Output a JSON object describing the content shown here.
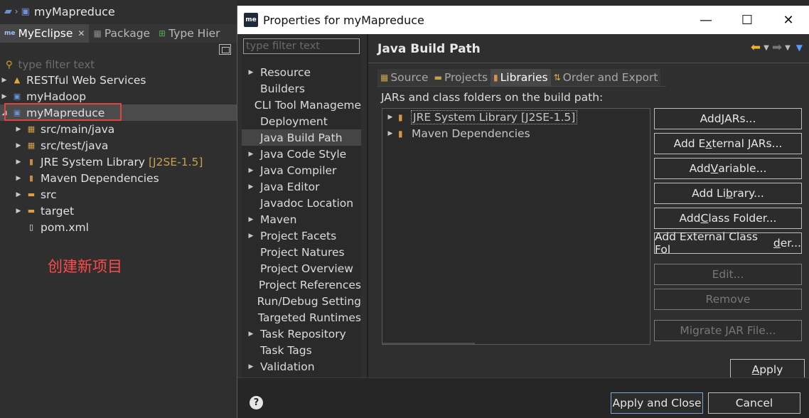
{
  "ide": {
    "breadcrumb": "myMapreduce",
    "view_tabs": [
      {
        "label": "MyEclipse",
        "active": true,
        "closable": true
      },
      {
        "label": "Package",
        "active": false
      },
      {
        "label": "Type Hier",
        "active": false
      }
    ],
    "filter_placeholder": "type filter text",
    "tree": [
      {
        "label": "RESTful Web Services",
        "icon": "rest-services-icon",
        "expanded": false,
        "level": 0
      },
      {
        "label": "myHadoop",
        "icon": "project-icon",
        "expanded": false,
        "level": 0
      },
      {
        "label": "myMapreduce",
        "icon": "project-icon",
        "expanded": true,
        "level": 0,
        "selected": true
      },
      {
        "label": "src/main/java",
        "icon": "source-folder-icon",
        "expanded": false,
        "level": 1
      },
      {
        "label": "src/test/java",
        "icon": "source-folder-icon",
        "expanded": false,
        "level": 1
      },
      {
        "label": "JRE System Library",
        "suffix": "[J2SE-1.5]",
        "icon": "library-icon",
        "expanded": false,
        "level": 1
      },
      {
        "label": "Maven Dependencies",
        "icon": "library-icon",
        "expanded": false,
        "level": 1
      },
      {
        "label": "src",
        "icon": "folder-icon",
        "expanded": false,
        "level": 1
      },
      {
        "label": "target",
        "icon": "folder-icon",
        "expanded": false,
        "level": 1
      },
      {
        "label": "pom.xml",
        "icon": "file-icon",
        "level": 1
      }
    ],
    "annotation": "创建新项目"
  },
  "dialog": {
    "logo": "me",
    "title": "Properties for myMapreduce",
    "window_buttons": {
      "minimize": "—",
      "maximize": "☐",
      "close": "✕"
    },
    "nav_filter_placeholder": "type filter text",
    "nav": [
      {
        "label": "Resource",
        "arrow": true
      },
      {
        "label": "Builders",
        "arrow": false
      },
      {
        "label": "CLI Tool Manageme",
        "arrow": false
      },
      {
        "label": "Deployment",
        "arrow": false
      },
      {
        "label": "Java Build Path",
        "arrow": false,
        "selected": true
      },
      {
        "label": "Java Code Style",
        "arrow": true
      },
      {
        "label": "Java Compiler",
        "arrow": true
      },
      {
        "label": "Java Editor",
        "arrow": true
      },
      {
        "label": "Javadoc Location",
        "arrow": false
      },
      {
        "label": "Maven",
        "arrow": true
      },
      {
        "label": "Project Facets",
        "arrow": true
      },
      {
        "label": "Project Natures",
        "arrow": false
      },
      {
        "label": "Project Overview",
        "arrow": false
      },
      {
        "label": "Project References",
        "arrow": false
      },
      {
        "label": "Run/Debug Setting",
        "arrow": false
      },
      {
        "label": "Targeted Runtimes",
        "arrow": false
      },
      {
        "label": "Task Repository",
        "arrow": true
      },
      {
        "label": "Task Tags",
        "arrow": false
      },
      {
        "label": "Validation",
        "arrow": true
      }
    ],
    "page_title": "Java Build Path",
    "tabs": [
      {
        "label": "Source",
        "icon": "source-tab-icon",
        "active": false
      },
      {
        "label": "Projects",
        "icon": "projects-tab-icon",
        "active": false
      },
      {
        "label": "Libraries",
        "icon": "libraries-tab-icon",
        "active": true
      },
      {
        "label": "Order and Export",
        "icon": "order-tab-icon",
        "active": false
      }
    ],
    "build_path_label": "JARs and class folders on the build path:",
    "libraries": [
      {
        "label": "JRE System Library [J2SE-1.5]",
        "focused": true
      },
      {
        "label": "Maven Dependencies",
        "focused": false
      }
    ],
    "buttons": [
      {
        "pre": "Add ",
        "ul": "J",
        "post": "ARs...",
        "enabled": true
      },
      {
        "pre": "Add E",
        "ul": "x",
        "post": "ternal JARs...",
        "enabled": true
      },
      {
        "pre": "Add ",
        "ul": "V",
        "post": "ariable...",
        "enabled": true
      },
      {
        "pre": "Add Li",
        "ul": "b",
        "post": "rary...",
        "enabled": true
      },
      {
        "pre": "Add ",
        "ul": "C",
        "post": "lass Folder...",
        "enabled": true
      },
      {
        "pre": "Add External Class Fol",
        "ul": "d",
        "post": "er...",
        "enabled": true
      },
      {
        "pre": "Edit...",
        "ul": "",
        "post": "",
        "enabled": false
      },
      {
        "pre": "Remove",
        "ul": "",
        "post": "",
        "enabled": false
      },
      {
        "pre": "Migrate JAR File...",
        "ul": "",
        "post": "",
        "enabled": false
      }
    ],
    "apply": {
      "ul": "A",
      "post": "pply"
    },
    "help": "?",
    "apply_and_close": "Apply and Close",
    "cancel": "Cancel"
  }
}
